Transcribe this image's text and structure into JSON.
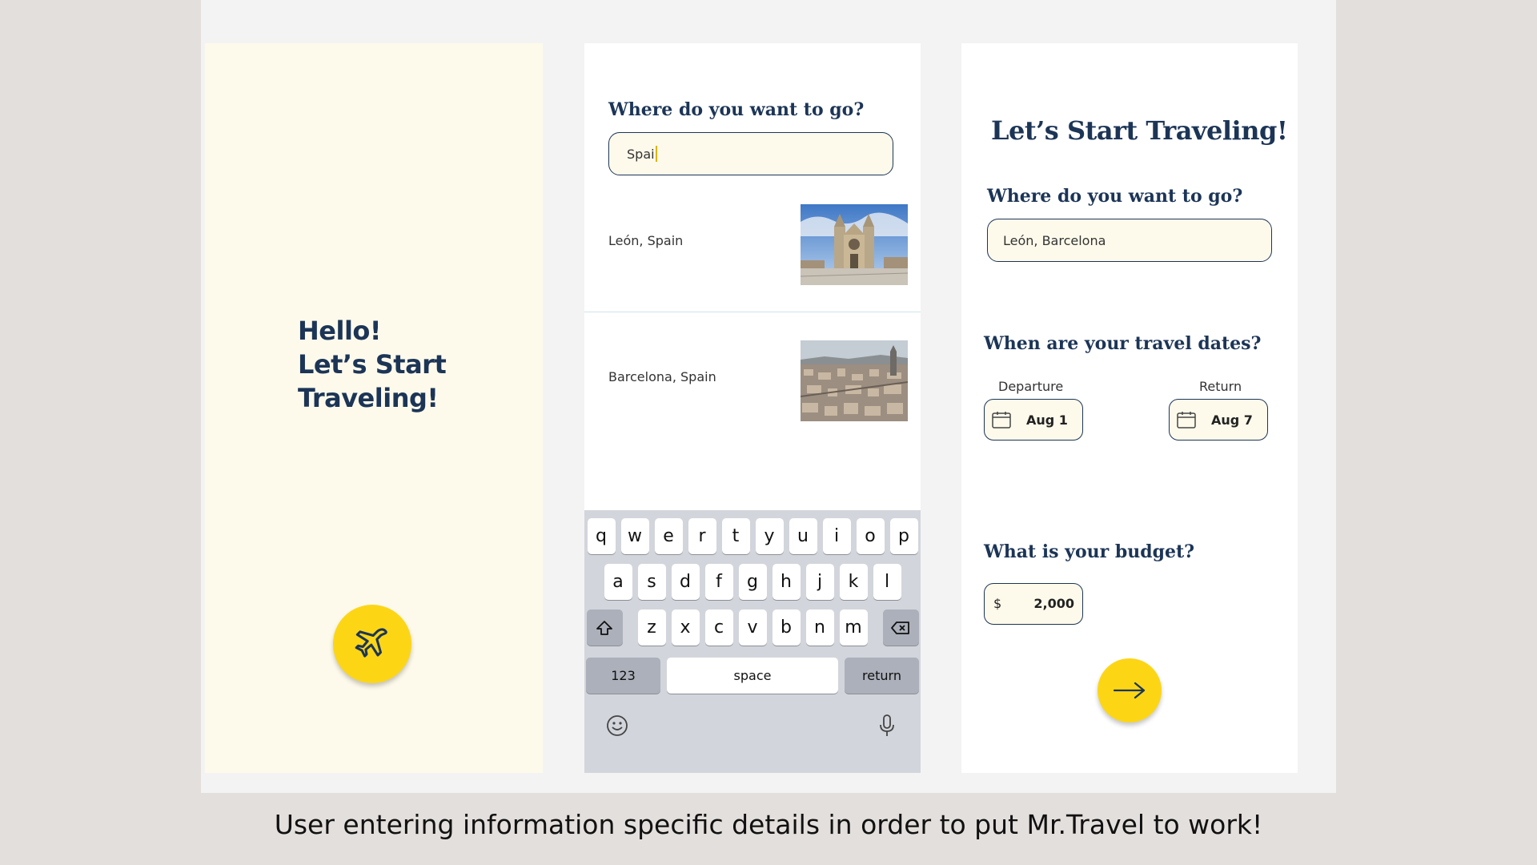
{
  "screen1": {
    "greeting_lines": [
      "Hello!",
      "Let’s Start",
      "Traveling!"
    ],
    "fab_icon": "airplane-icon",
    "fab_color": "#fcd615"
  },
  "screen2": {
    "question": "Where do you want to go?",
    "search_value": "Spai",
    "results": [
      {
        "label": "León, Spain",
        "image": "leon-cathedral-photo"
      },
      {
        "label": "Barcelona, Spain",
        "image": "barcelona-city-photo"
      }
    ],
    "keyboard": {
      "row1": [
        "q",
        "w",
        "e",
        "r",
        "t",
        "y",
        "u",
        "i",
        "o",
        "p"
      ],
      "row2": [
        "a",
        "s",
        "d",
        "f",
        "g",
        "h",
        "j",
        "k",
        "l"
      ],
      "row3": [
        "z",
        "x",
        "c",
        "v",
        "b",
        "n",
        "m"
      ],
      "numbers_label": "123",
      "space_label": "space",
      "return_label": "return"
    }
  },
  "screen3": {
    "title": "Let’s Start Traveling!",
    "destination_question": "Where do you want to go?",
    "destination_value": "León, Barcelona",
    "dates_question": "When are your travel dates?",
    "departure_label": "Departure",
    "departure_value": "Aug 1",
    "return_label": "Return",
    "return_value": "Aug 7",
    "budget_question": "What is your budget?",
    "budget_currency": "$",
    "budget_value": "2,000",
    "fab_icon": "arrow-right-icon"
  },
  "caption": "User entering information specific details in order to put Mr.Travel to work!",
  "colors": {
    "navy": "#1c3557",
    "yellow": "#fcd615",
    "cream": "#fefaeb"
  }
}
